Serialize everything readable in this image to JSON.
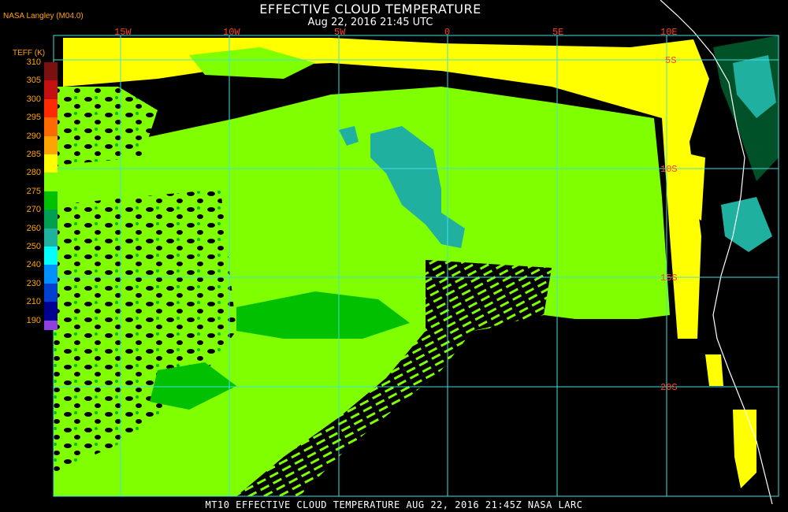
{
  "header": {
    "title": "EFFECTIVE CLOUD TEMPERATURE",
    "subtitle": "Aug 22, 2016 21:45 UTC",
    "credit": "NASA Langley (M04.0)"
  },
  "legend": {
    "title": "TEFF (K)",
    "labels": [
      "310",
      "305",
      "300",
      "295",
      "290",
      "285",
      "280",
      "275",
      "270",
      "260",
      "250",
      "240",
      "230",
      "210",
      "190"
    ],
    "colors": [
      "#7a1010",
      "#c41010",
      "#ff2a00",
      "#ff6a00",
      "#ffa500",
      "#ffff00",
      "#80ff00",
      "#00c000",
      "#00a050",
      "#20b0a0",
      "#00ffff",
      "#0090ff",
      "#0040d0",
      "#000090",
      "#9040e0"
    ]
  },
  "map": {
    "longitude_labels": [
      "15W",
      "10W",
      "5W",
      "0",
      "5E",
      "10E"
    ],
    "latitude_labels": [
      "5S",
      "10S",
      "15S",
      "20S"
    ],
    "colors": {
      "background": "#000000",
      "grid": "#40e0e0",
      "coast": "#ffffff",
      "warm_low_cloud": "#ffff00",
      "low_cloud": "#80ff00",
      "mid_cloud": "#00c000",
      "cool_cloud": "#20b0a0",
      "land_cloud": "#00a050"
    }
  },
  "footer": {
    "text": "MT10  EFFECTIVE CLOUD TEMPERATURE   AUG 22, 2016 21:45Z   NASA LARC"
  }
}
